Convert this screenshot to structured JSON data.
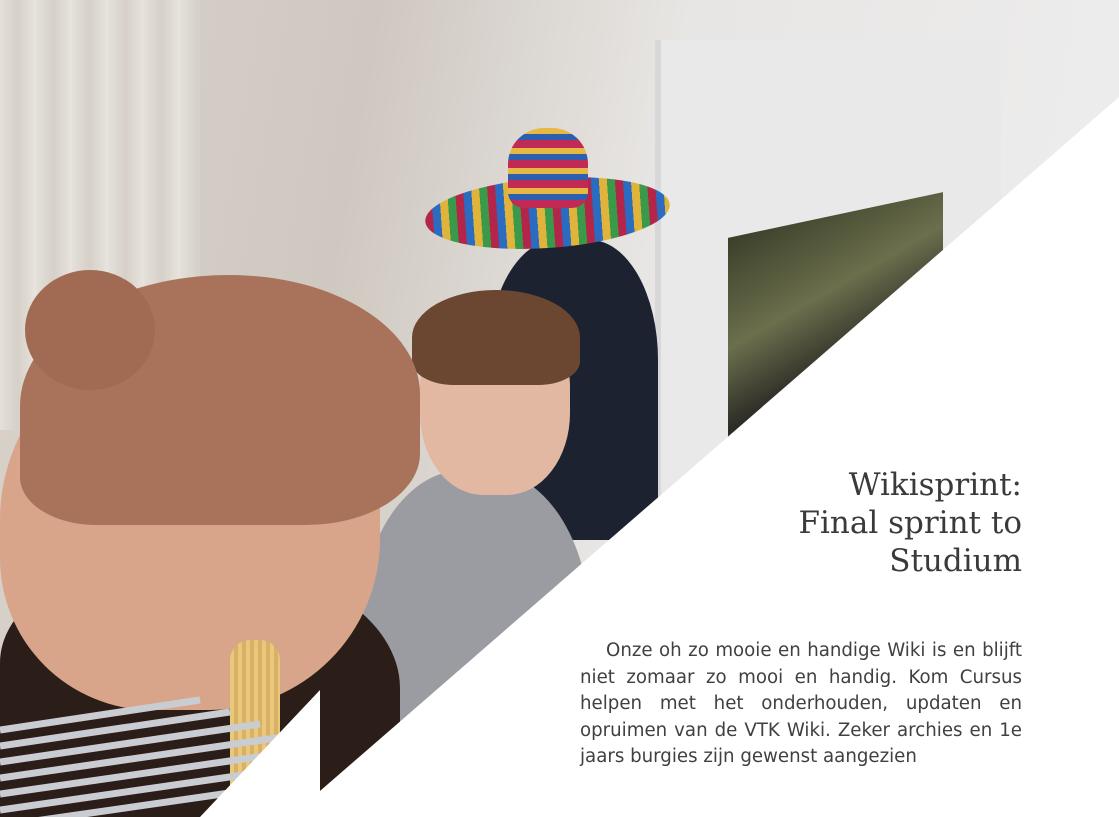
{
  "article": {
    "title": "Wikisprint:\nFinal sprint to\nStudium",
    "body": "Onze oh zo mooie en handige Wiki is en blijft niet zomaar zo mooi en handig. Kom Cursus helpen met het onderhouden, updaten en opruimen van de VTK Wiki. Zeker archies en 1e jaars burgies zijn gewenst aangezien"
  },
  "colors": {
    "background": "#ffffff",
    "text": "#404040",
    "stripes": "#c9ccd1"
  }
}
